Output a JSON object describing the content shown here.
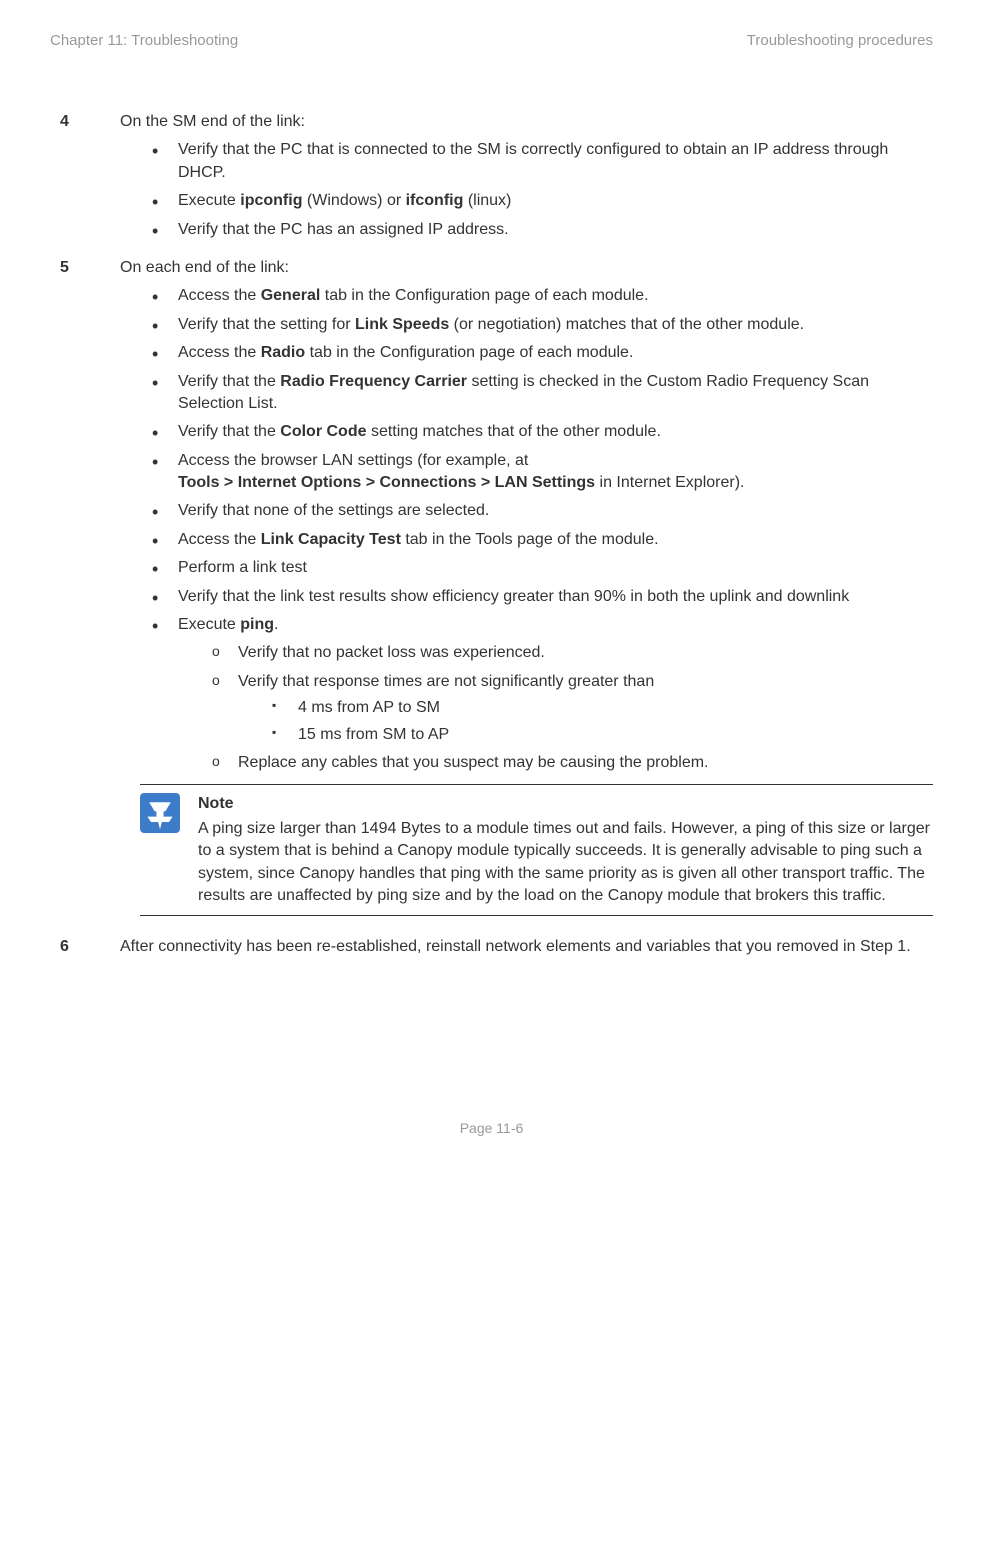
{
  "header": {
    "left": "Chapter 11:  Troubleshooting",
    "right": "Troubleshooting procedures"
  },
  "step4": {
    "num": "4",
    "title": "On the SM end of the link:",
    "b1": "Verify that the PC that is connected to the SM is correctly configured to obtain an IP address through DHCP.",
    "b2_pre": "Execute ",
    "b2_bold1": "ipconfig",
    "b2_mid": " (Windows) or ",
    "b2_bold2": "ifconfig",
    "b2_post": " (linux)",
    "b3": "Verify that the PC has an assigned IP address."
  },
  "step5": {
    "num": "5",
    "title": "On each end of the link:",
    "b1_pre": "Access the ",
    "b1_bold": "General",
    "b1_post": " tab in the Configuration page of each module.",
    "b2_pre": "Verify that the setting for ",
    "b2_bold": "Link Speeds",
    "b2_post": " (or negotiation) matches that of the other module.",
    "b3_pre": "Access the ",
    "b3_bold": "Radio",
    "b3_post": " tab in the Configuration page of each module.",
    "b4_pre": "Verify that the ",
    "b4_bold": "Radio Frequency Carrier",
    "b4_post": " setting is checked in the Custom Radio Frequency Scan Selection List.",
    "b5_pre": "Verify that the ",
    "b5_bold": "Color Code",
    "b5_post": " setting matches that of the other module.",
    "b6_line1": "Access the browser LAN settings (for example, at",
    "b6_bold": "Tools > Internet Options > Connections > LAN Settings",
    "b6_post": " in Internet Explorer).",
    "b7": "Verify that none of the settings are selected.",
    "b8_pre": "Access the ",
    "b8_bold": "Link Capacity Test",
    "b8_post": " tab in the Tools page of the module.",
    "b9": "Perform a link test",
    "b10": "Verify that the link test results show efficiency greater than 90% in both the uplink and downlink",
    "b11_pre": "Execute ",
    "b11_bold": "ping",
    "b11_post": ".",
    "o1": "Verify that no packet loss was experienced.",
    "o2": "Verify that response times are not significantly greater than",
    "sq1": "4 ms from AP to SM",
    "sq2": "15 ms from SM to AP",
    "o3": "Replace any cables that you suspect may be causing the problem.",
    "note_title": "Note",
    "note_body": "A ping size larger than 1494 Bytes to a module times out and fails. However, a ping of this size or larger to a system that is behind a Canopy module typically succeeds. It is generally advisable to ping such a system, since Canopy handles that ping with the same priority as is given all other transport traffic. The results are unaffected by ping size and by the load on the Canopy module that brokers this traffic."
  },
  "step6": {
    "num": "6",
    "body": "After connectivity has been re-established, reinstall network elements and variables that you removed in Step 1."
  },
  "footer": "Page 11-6"
}
